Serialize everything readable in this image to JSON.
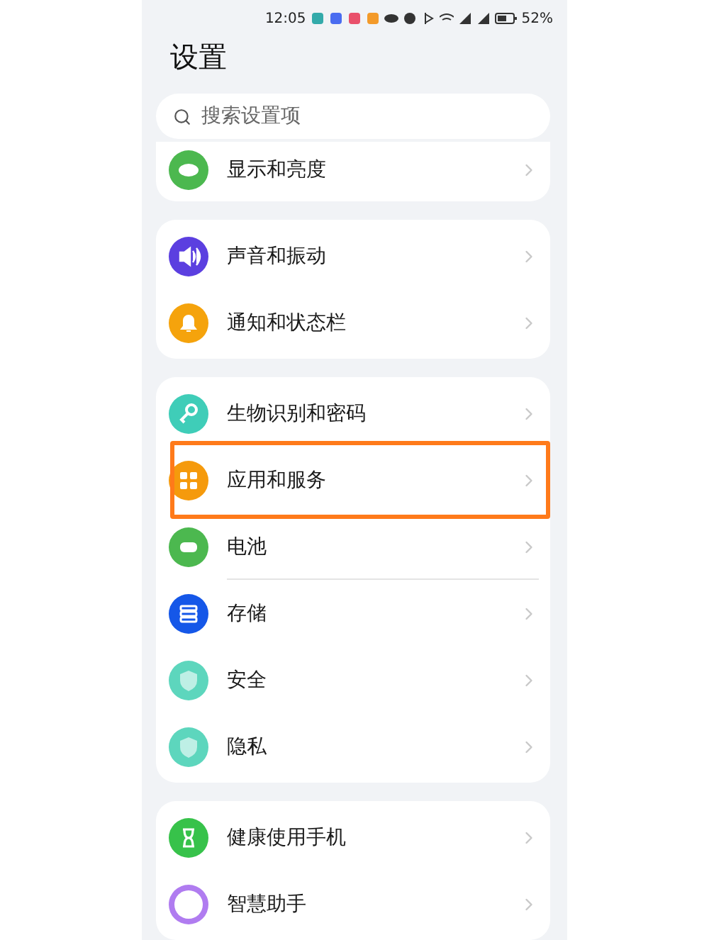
{
  "status_bar": {
    "time": "12:05",
    "battery": "52%"
  },
  "title": "设置",
  "search": {
    "placeholder": "搜索设置项"
  },
  "groups": [
    {
      "partial": true,
      "items": [
        {
          "label": "显示和亮度",
          "color": "#4cb84f",
          "highlighted": false,
          "divider": false
        }
      ]
    },
    {
      "partial": false,
      "items": [
        {
          "label": "声音和振动",
          "color": "#5b3fe0",
          "highlighted": false,
          "divider": false
        },
        {
          "label": "通知和状态栏",
          "color": "#f5a30c",
          "highlighted": false,
          "divider": false
        }
      ]
    },
    {
      "partial": false,
      "items": [
        {
          "label": "生物识别和密码",
          "color": "#3fcdb8",
          "highlighted": false,
          "divider": false
        },
        {
          "label": "应用和服务",
          "color": "#f59a0c",
          "highlighted": true,
          "divider": false
        },
        {
          "label": "电池",
          "color": "#4cb84f",
          "highlighted": false,
          "divider": true
        },
        {
          "label": "存储",
          "color": "#1557e8",
          "highlighted": false,
          "divider": false
        },
        {
          "label": "安全",
          "color": "#5dd6bd",
          "highlighted": false,
          "divider": false
        },
        {
          "label": "隐私",
          "color": "#5dd6bd",
          "highlighted": false,
          "divider": false
        }
      ]
    },
    {
      "partial": false,
      "items": [
        {
          "label": "健康使用手机",
          "color": "#37c24a",
          "highlighted": false,
          "divider": false
        },
        {
          "label": "智慧助手",
          "color": "#b07cf0",
          "highlighted": false,
          "divider": false
        }
      ]
    }
  ]
}
